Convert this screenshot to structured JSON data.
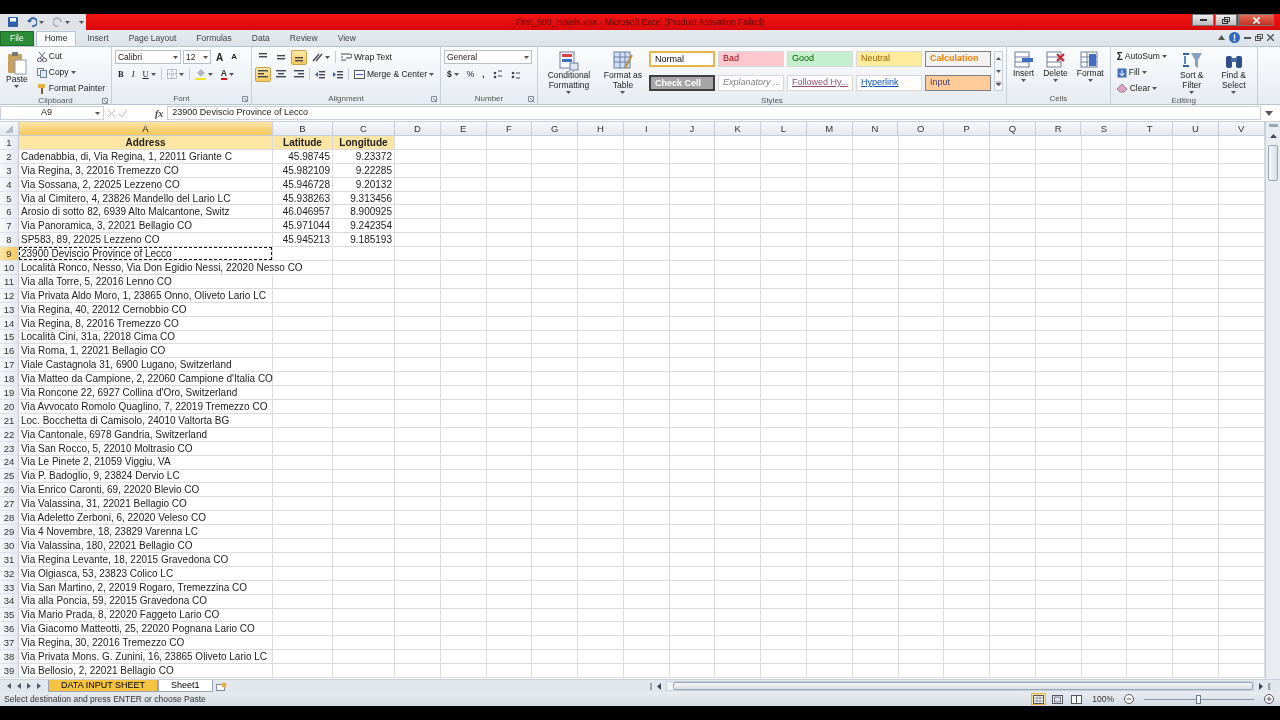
{
  "window": {
    "title": "First_500_Hotels.xlsx - Microsoft Excel (Product Activation Failed)"
  },
  "ribbon_tabs": [
    {
      "label": "File",
      "kind": "backstage",
      "selected": false
    },
    {
      "label": "Home",
      "kind": "tab",
      "selected": true
    },
    {
      "label": "Insert",
      "kind": "tab",
      "selected": false
    },
    {
      "label": "Page Layout",
      "kind": "tab",
      "selected": false
    },
    {
      "label": "Formulas",
      "kind": "tab",
      "selected": false
    },
    {
      "label": "Data",
      "kind": "tab",
      "selected": false
    },
    {
      "label": "Review",
      "kind": "tab",
      "selected": false
    },
    {
      "label": "View",
      "kind": "tab",
      "selected": false
    }
  ],
  "ribbon": {
    "clipboard": {
      "label": "Clipboard",
      "paste": "Paste",
      "cut": "Cut",
      "copy": "Copy",
      "format_painter": "Format Painter"
    },
    "font": {
      "label": "Font",
      "font_name": "Calibri",
      "font_size": "12",
      "grow": "A",
      "shrink": "A",
      "bold": "B",
      "italic": "I",
      "underline": "U",
      "font_color": "A"
    },
    "alignment": {
      "label": "Alignment",
      "wrap_text": "Wrap Text",
      "merge": "Merge & Center",
      "vertical_align": [
        {
          "selected": false
        },
        {
          "selected": false
        },
        {
          "selected": true
        }
      ],
      "horizontal_align": [
        {
          "selected": true
        },
        {
          "selected": false
        },
        {
          "selected": false
        }
      ]
    },
    "number": {
      "label": "Number",
      "format": "General",
      "currency": "$",
      "percent": "%",
      "comma": ","
    },
    "styles": {
      "label": "Styles",
      "conditional": "Conditional Formatting",
      "format_table": "Format as Table",
      "options": [
        {
          "label": "Normal",
          "kind": "normal",
          "selected": true
        },
        {
          "label": "Bad",
          "kind": "bad",
          "selected": false
        },
        {
          "label": "Good",
          "kind": "good",
          "selected": false
        },
        {
          "label": "Neutral",
          "kind": "neutral",
          "selected": false
        },
        {
          "label": "Calculation",
          "kind": "calculation",
          "selected": false
        },
        {
          "label": "Check Cell",
          "kind": "check",
          "selected": false
        },
        {
          "label": "Explanatory ...",
          "kind": "explanatory",
          "selected": false
        },
        {
          "label": "Followed Hy...",
          "kind": "followed",
          "selected": false
        },
        {
          "label": "Hyperlink",
          "kind": "hyperlink",
          "selected": false
        },
        {
          "label": "Input",
          "kind": "input",
          "selected": false
        }
      ]
    },
    "cells": {
      "label": "Cells",
      "insert": "Insert",
      "delete": "Delete",
      "format": "Format"
    },
    "editing": {
      "label": "Editing",
      "autosum_symbol": "Σ",
      "autosum": "AutoSum",
      "fill": "Fill",
      "clear": "Clear",
      "sort": "Sort & Filter",
      "find": "Find & Select"
    }
  },
  "formula_bar": {
    "name_box": "A9",
    "function_symbol": "fx",
    "content": "23900 Deviscio Province of Lecco"
  },
  "sheet": {
    "copy_marquee": true,
    "columns": [
      {
        "label": "A",
        "selected": true
      },
      {
        "label": "B",
        "selected": false
      },
      {
        "label": "C",
        "selected": false
      },
      {
        "label": "D",
        "selected": false
      },
      {
        "label": "E",
        "selected": false
      },
      {
        "label": "F",
        "selected": false
      },
      {
        "label": "G",
        "selected": false
      },
      {
        "label": "H",
        "selected": false
      },
      {
        "label": "I",
        "selected": false
      },
      {
        "label": "J",
        "selected": false
      },
      {
        "label": "K",
        "selected": false
      },
      {
        "label": "L",
        "selected": false
      },
      {
        "label": "M",
        "selected": false
      },
      {
        "label": "N",
        "selected": false
      },
      {
        "label": "O",
        "selected": false
      },
      {
        "label": "P",
        "selected": false
      },
      {
        "label": "Q",
        "selected": false
      },
      {
        "label": "R",
        "selected": false
      },
      {
        "label": "S",
        "selected": false
      },
      {
        "label": "T",
        "selected": false
      },
      {
        "label": "U",
        "selected": false
      },
      {
        "label": "V",
        "selected": false
      }
    ],
    "rows": [
      {
        "number": "1",
        "kind": "header",
        "selected": false,
        "cells": [
          "Address",
          "Latitude",
          "Longitude"
        ]
      },
      {
        "number": "2",
        "kind": "data",
        "selected": false,
        "cells": [
          "Cadenabbia, di, Via Regina, 1, 22011 Griante C",
          "45.98745",
          "9.23372"
        ]
      },
      {
        "number": "3",
        "kind": "data",
        "selected": false,
        "cells": [
          "Via Regina, 3, 22016 Tremezzo CO",
          "45.982109",
          "9.22285"
        ]
      },
      {
        "number": "4",
        "kind": "data",
        "selected": false,
        "cells": [
          "Via Sossana, 2, 22025 Lezzeno CO",
          "45.946728",
          "9.20132"
        ]
      },
      {
        "number": "5",
        "kind": "data",
        "selected": false,
        "cells": [
          "Via al Cimitero, 4, 23826 Mandello del Lario LC",
          "45.938263",
          "9.313456"
        ]
      },
      {
        "number": "6",
        "kind": "data",
        "selected": false,
        "cells": [
          "Arosio di sotto 82, 6939 Alto Malcantone, Switz",
          "46.046957",
          "8.900925"
        ]
      },
      {
        "number": "7",
        "kind": "data",
        "selected": false,
        "cells": [
          "Via Panoramica, 3, 22021 Bellagio CO",
          "45.971044",
          "9.242354"
        ]
      },
      {
        "number": "8",
        "kind": "data",
        "selected": false,
        "cells": [
          "SP583, 89, 22025 Lezzeno CO",
          "45.945213",
          "9.185193"
        ]
      },
      {
        "number": "9",
        "kind": "data",
        "selected": true,
        "cells": [
          "23900 Deviscio Province of Lecco"
        ]
      },
      {
        "number": "10",
        "kind": "data",
        "selected": false,
        "cells": [
          "Località Ronco, Nesso, Via Don Egidio Nessi, 22020 Nesso CO"
        ]
      },
      {
        "number": "11",
        "kind": "data",
        "selected": false,
        "cells": [
          "Via alla Torre, 5, 22016 Lenno CO"
        ]
      },
      {
        "number": "12",
        "kind": "data",
        "selected": false,
        "cells": [
          "Via Privata Aldo Moro, 1, 23865 Onno, Oliveto Lario LC"
        ]
      },
      {
        "number": "13",
        "kind": "data",
        "selected": false,
        "cells": [
          "Via Regina, 40, 22012 Cernobbio CO"
        ]
      },
      {
        "number": "14",
        "kind": "data",
        "selected": false,
        "cells": [
          "Via Regina, 8, 22016 Tremezzo CO"
        ]
      },
      {
        "number": "15",
        "kind": "data",
        "selected": false,
        "cells": [
          "Località Cini, 31a, 22018 Cima CO"
        ]
      },
      {
        "number": "16",
        "kind": "data",
        "selected": false,
        "cells": [
          "Via Roma, 1, 22021 Bellagio CO"
        ]
      },
      {
        "number": "17",
        "kind": "data",
        "selected": false,
        "cells": [
          "Viale Castagnola 31, 6900 Lugano, Switzerland"
        ]
      },
      {
        "number": "18",
        "kind": "data",
        "selected": false,
        "cells": [
          "Via Matteo da Campione, 2, 22060 Campione d'Italia CO"
        ]
      },
      {
        "number": "19",
        "kind": "data",
        "selected": false,
        "cells": [
          "Via Roncone 22, 6927 Collina d'Oro, Switzerland"
        ]
      },
      {
        "number": "20",
        "kind": "data",
        "selected": false,
        "cells": [
          "Via Avvocato Romolo Quaglino, 7, 22019 Tremezzo CO"
        ]
      },
      {
        "number": "21",
        "kind": "data",
        "selected": false,
        "cells": [
          "Loc. Bocchetta di Camisolo, 24010 Valtorta BG"
        ]
      },
      {
        "number": "22",
        "kind": "data",
        "selected": false,
        "cells": [
          "Via Cantonale, 6978 Gandria, Switzerland"
        ]
      },
      {
        "number": "23",
        "kind": "data",
        "selected": false,
        "cells": [
          "Via San Rocco, 5, 22010 Moltrasio CO"
        ]
      },
      {
        "number": "24",
        "kind": "data",
        "selected": false,
        "cells": [
          "Via Le Pinete 2, 21059 Viggiu, VA"
        ]
      },
      {
        "number": "25",
        "kind": "data",
        "selected": false,
        "cells": [
          "Via P. Badoglio, 9, 23824 Dervio LC"
        ]
      },
      {
        "number": "26",
        "kind": "data",
        "selected": false,
        "cells": [
          "Via Enrico Caronti, 69, 22020 Blevio CO"
        ]
      },
      {
        "number": "27",
        "kind": "data",
        "selected": false,
        "cells": [
          "Via Valassina, 31, 22021 Bellagio CO"
        ]
      },
      {
        "number": "28",
        "kind": "data",
        "selected": false,
        "cells": [
          "Via Adeletto Zerboni, 6, 22020 Veleso CO"
        ]
      },
      {
        "number": "29",
        "kind": "data",
        "selected": false,
        "cells": [
          "Via 4 Novembre, 18, 23829 Varenna LC"
        ]
      },
      {
        "number": "30",
        "kind": "data",
        "selected": false,
        "cells": [
          "Via Valassina, 180, 22021 Bellagio CO"
        ]
      },
      {
        "number": "31",
        "kind": "data",
        "selected": false,
        "cells": [
          "Via Regina Levante, 18, 22015 Gravedona CO"
        ]
      },
      {
        "number": "32",
        "kind": "data",
        "selected": false,
        "cells": [
          "Via Olgiasca, 53, 23823 Colico LC"
        ]
      },
      {
        "number": "33",
        "kind": "data",
        "selected": false,
        "cells": [
          "Via San Martino, 2, 22019 Rogaro, Tremezzina CO"
        ]
      },
      {
        "number": "34",
        "kind": "data",
        "selected": false,
        "cells": [
          "Via alla Poncia, 59, 22015 Gravedona CO"
        ]
      },
      {
        "number": "35",
        "kind": "data",
        "selected": false,
        "cells": [
          "Via Mario Prada, 8, 22020 Faggeto Lario CO"
        ]
      },
      {
        "number": "36",
        "kind": "data",
        "selected": false,
        "cells": [
          "Via Giacomo Matteotti, 25, 22020 Pognana Lario CO"
        ]
      },
      {
        "number": "37",
        "kind": "data",
        "selected": false,
        "cells": [
          "Via Regina, 30, 22016 Tremezzo CO"
        ]
      },
      {
        "number": "38",
        "kind": "data",
        "selected": false,
        "cells": [
          "Via Privata Mons. G. Zunini, 16, 23865 Oliveto Lario LC"
        ]
      },
      {
        "number": "39",
        "kind": "data",
        "selected": false,
        "cells": [
          "Via Bellosio, 2, 22021 Bellagio CO"
        ]
      }
    ]
  },
  "sheet_tabs": [
    {
      "label": "DATA INPUT SHEET",
      "selected": true
    },
    {
      "label": "Sheet1",
      "selected": false
    }
  ],
  "status_bar": {
    "message": "Select destination and press ENTER or choose Paste",
    "zoom": "100%",
    "zoom_slider": {
      "level": 0.5
    },
    "views": [
      {
        "kind": "normal",
        "selected": true
      },
      {
        "kind": "page_layout",
        "selected": false
      },
      {
        "kind": "page_break",
        "selected": false
      }
    ]
  }
}
